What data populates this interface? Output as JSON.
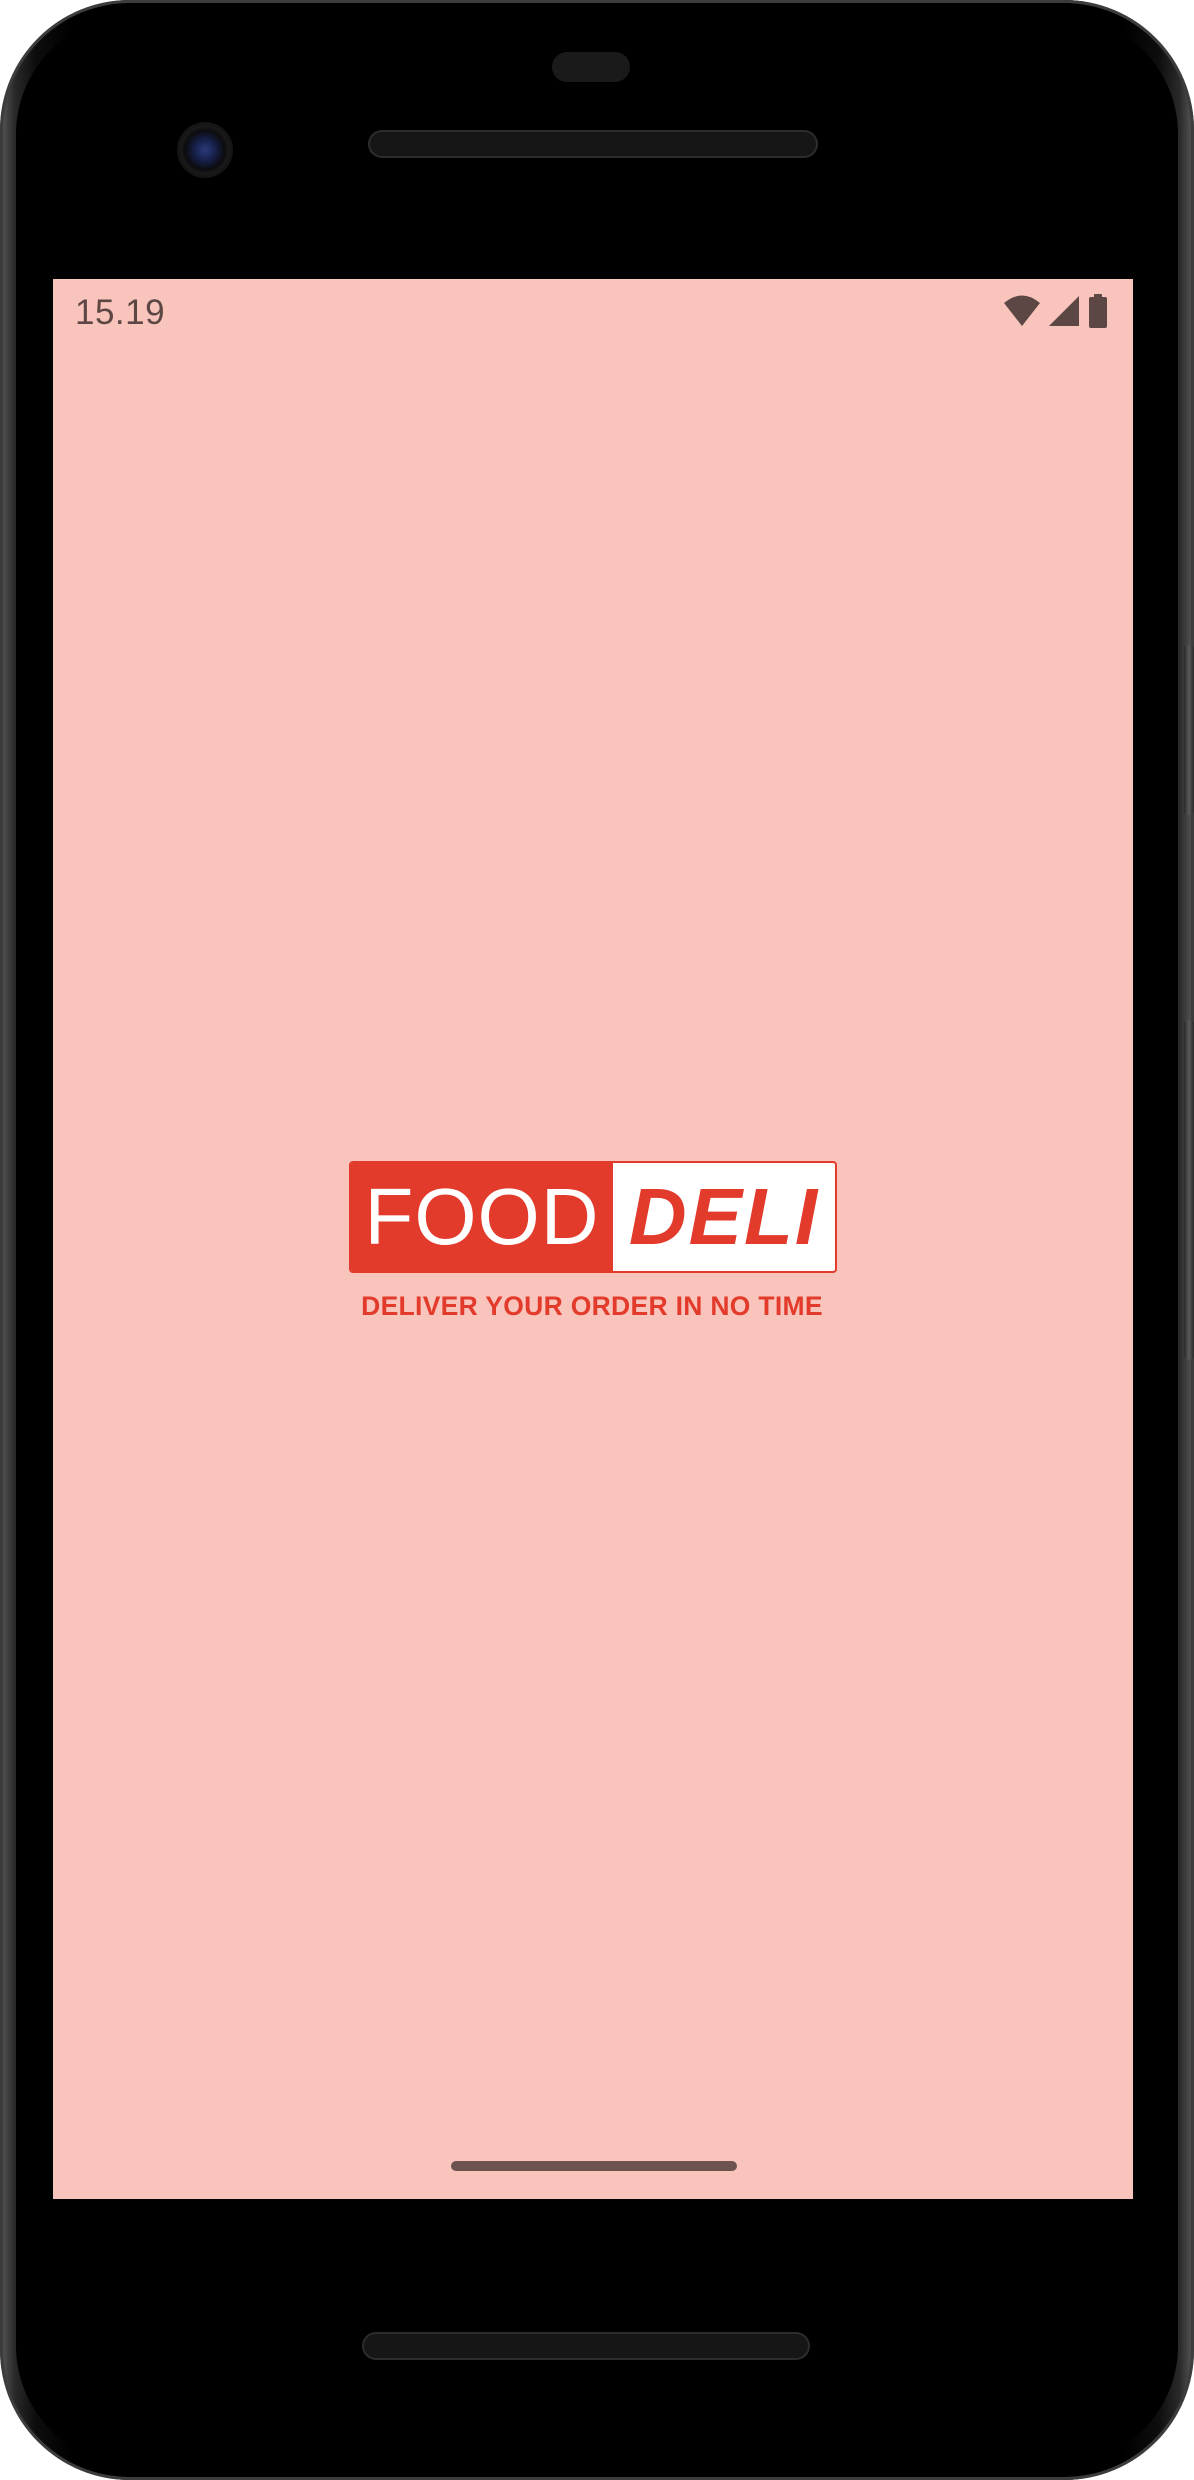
{
  "status_bar": {
    "time": "15.19",
    "icons": [
      "wifi-icon",
      "cell-signal-icon",
      "battery-icon"
    ]
  },
  "logo": {
    "word_food": "FOOD",
    "word_deli": "DELI",
    "tagline": "DELIVER YOUR ORDER IN NO TIME",
    "brand_color": "#e33b2b"
  },
  "colors": {
    "screen_background": "#f9c4bb",
    "status_text": "#5c4744"
  }
}
